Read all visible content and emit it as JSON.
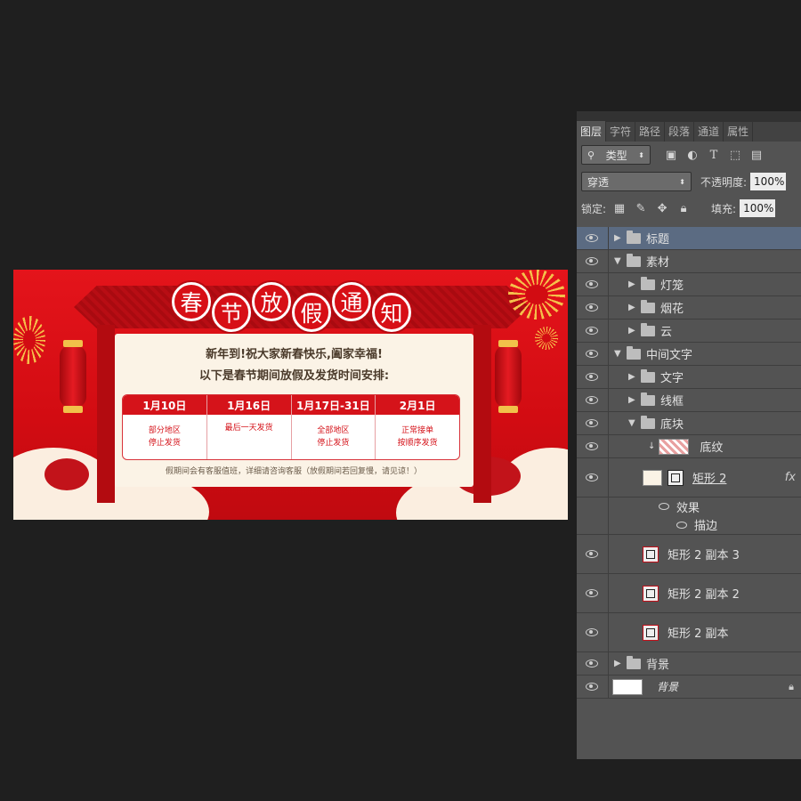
{
  "banner": {
    "title_chars": [
      "春",
      "节",
      "放",
      "假",
      "通",
      "知"
    ],
    "line1": "新年到!祝大家新春快乐,阖家幸福!",
    "line2": "以下是春节期间放假及发货时间安排:",
    "schedule": [
      {
        "date": "1月10日",
        "lines": [
          "部分地区",
          "停止发货"
        ]
      },
      {
        "date": "1月16日",
        "lines": [
          "最后一天发货"
        ]
      },
      {
        "date": "1月17日-31日",
        "lines": [
          "全部地区",
          "停止发货"
        ]
      },
      {
        "date": "2月1日",
        "lines": [
          "正常接单",
          "按顺序发货"
        ]
      }
    ],
    "footnote": "假期间会有客服值班，详细请咨询客服（放假期间若回复慢，请见谅！）",
    "colors": {
      "red": "#d5131a",
      "paper": "#fbf3e6",
      "gold": "#f5c04a"
    }
  },
  "panel": {
    "tabs": [
      {
        "label": "图层",
        "active": true
      },
      {
        "label": "字符",
        "active": false
      },
      {
        "label": "路径",
        "active": false
      },
      {
        "label": "段落",
        "active": false
      },
      {
        "label": "通道",
        "active": false
      },
      {
        "label": "属性",
        "active": false
      }
    ],
    "filter": {
      "label": "类型",
      "icon": "search-icon"
    },
    "filter_icons": [
      "image-filter-icon",
      "adjustment-filter-icon",
      "text-filter-icon",
      "shape-filter-icon",
      "smart-object-filter-icon"
    ],
    "blend_mode": "穿透",
    "opacity_label": "不透明度:",
    "opacity_value": "100%",
    "lock_label": "锁定:",
    "fill_label": "填充:",
    "fill_value": "100%",
    "layers": [
      {
        "name": "标题",
        "type": "group",
        "level": 0,
        "expanded": false,
        "selected": true
      },
      {
        "name": "素材",
        "type": "group",
        "level": 0,
        "expanded": true
      },
      {
        "name": "灯笼",
        "type": "group",
        "level": 1,
        "expanded": false
      },
      {
        "name": "烟花",
        "type": "group",
        "level": 1,
        "expanded": false
      },
      {
        "name": "云",
        "type": "group",
        "level": 1,
        "expanded": false
      },
      {
        "name": "中间文字",
        "type": "group",
        "level": 0,
        "expanded": true
      },
      {
        "name": "文字",
        "type": "group",
        "level": 1,
        "expanded": false
      },
      {
        "name": "线框",
        "type": "group",
        "level": 1,
        "expanded": false
      },
      {
        "name": "底块",
        "type": "group",
        "level": 1,
        "expanded": true
      },
      {
        "name": "底纹",
        "type": "clipped",
        "level": 2
      },
      {
        "name": "矩形 2",
        "type": "shape",
        "level": 2,
        "fx": "fx"
      },
      {
        "name": "效果",
        "type": "effect",
        "level": 3
      },
      {
        "name": "描边",
        "type": "effect",
        "level": 4
      },
      {
        "name": "矩形 2 副本 3",
        "type": "shape",
        "level": 2
      },
      {
        "name": "矩形 2 副本 2",
        "type": "shape",
        "level": 2
      },
      {
        "name": "矩形 2 副本",
        "type": "shape",
        "level": 2
      },
      {
        "name": "背景",
        "type": "group",
        "level": 0,
        "expanded": false
      },
      {
        "name": "背景",
        "type": "background",
        "level": 0,
        "locked": true
      }
    ]
  }
}
